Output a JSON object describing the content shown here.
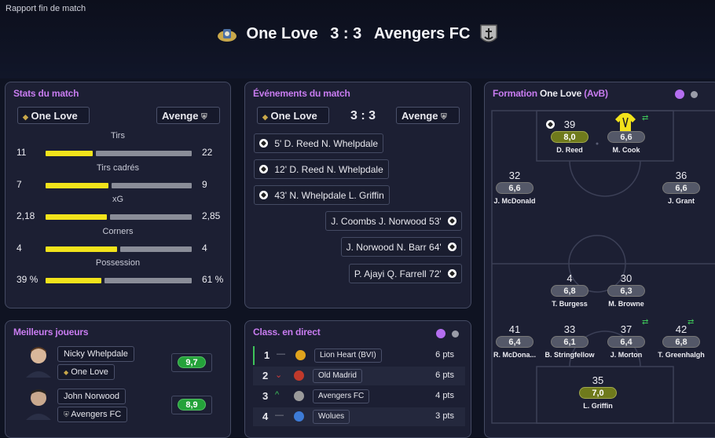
{
  "header": {
    "title": "Rapport fin de match",
    "home_team": "One Love",
    "score": "3 : 3",
    "away_team": "Avengers FC"
  },
  "stats": {
    "title": "Stats du match",
    "home_pill": "One Love",
    "away_pill": "Avenge",
    "items": [
      {
        "label": "Tirs",
        "home": "11",
        "away": "22",
        "home_share": 0.33
      },
      {
        "label": "Tirs cadrés",
        "home": "7",
        "away": "9",
        "home_share": 0.44
      },
      {
        "label": "xG",
        "home": "2,18",
        "away": "2,85",
        "home_share": 0.43
      },
      {
        "label": "Corners",
        "home": "4",
        "away": "4",
        "home_share": 0.5
      },
      {
        "label": "Possession",
        "home": "39 %",
        "away": "61 %",
        "home_share": 0.39
      }
    ]
  },
  "events": {
    "title": "Événements du match",
    "home_pill": "One Love",
    "away_pill": "Avenge",
    "score": "3 : 3",
    "home": [
      {
        "minute": "5'",
        "scorer": "D. Reed",
        "assist": "N. Whelpdale"
      },
      {
        "minute": "12'",
        "scorer": "D. Reed",
        "assist": "N. Whelpdale"
      },
      {
        "minute": "43'",
        "scorer": "N. Whelpdale",
        "assist": "L. Griffin"
      }
    ],
    "away": [
      {
        "minute": "53'",
        "scorer": "J. Norwood",
        "assist": "J. Coombs"
      },
      {
        "minute": "64'",
        "scorer": "N. Barr",
        "assist": "J. Norwood"
      },
      {
        "minute": "72'",
        "scorer": "Q. Farrell",
        "assist": "P. Ajayi"
      }
    ]
  },
  "best_players": {
    "title": "Meilleurs joueurs",
    "players": [
      {
        "name": "Nicky Whelpdale",
        "team": "One Love",
        "rating": "9,7"
      },
      {
        "name": "John Norwood",
        "team": "Avengers FC",
        "rating": "8,9"
      }
    ]
  },
  "standings": {
    "title": "Class. en direct",
    "rows": [
      {
        "pos": "1",
        "trend": "—",
        "team": "Lion Heart (BVI)",
        "pts": "6 pts"
      },
      {
        "pos": "2",
        "trend": "⌄",
        "team": "Old Madrid",
        "pts": "6 pts"
      },
      {
        "pos": "3",
        "trend": "^",
        "team": "Avengers FC",
        "pts": "4 pts"
      },
      {
        "pos": "4",
        "trend": "—",
        "team": "Wolues",
        "pts": "3 pts"
      }
    ]
  },
  "formation": {
    "title_prefix": "Formation",
    "team": "One Love",
    "suffix": "(AvB)",
    "players": [
      {
        "num": "39",
        "rating": "8,0",
        "name": "D. Reed",
        "style": "r-olive"
      },
      {
        "num": "",
        "rating": "6,6",
        "name": "M. Cook",
        "style": "r-gray"
      },
      {
        "num": "32",
        "rating": "6,6",
        "name": "J. McDonald",
        "style": "r-gray"
      },
      {
        "num": "36",
        "rating": "6,6",
        "name": "J. Grant",
        "style": "r-gray"
      },
      {
        "num": "4",
        "rating": "6,8",
        "name": "T. Burgess",
        "style": "r-gray"
      },
      {
        "num": "30",
        "rating": "6,3",
        "name": "M. Browne",
        "style": "r-gray"
      },
      {
        "num": "41",
        "rating": "6,4",
        "name": "R. McDona...",
        "style": "r-gray"
      },
      {
        "num": "33",
        "rating": "6,1",
        "name": "B. Stringfellow",
        "style": "r-gray"
      },
      {
        "num": "37",
        "rating": "6,4",
        "name": "J. Morton",
        "style": "r-gray"
      },
      {
        "num": "42",
        "rating": "6,8",
        "name": "T. Greenhalgh",
        "style": "r-gray"
      },
      {
        "num": "35",
        "rating": "7,0",
        "name": "L. Griffin",
        "style": "r-olive"
      }
    ]
  },
  "colors": {
    "accent": "#c87cf0",
    "stat_home_bar": "#f2e31b",
    "stat_away_bar": "#8a8d98",
    "rating_green": "#24a23a"
  }
}
